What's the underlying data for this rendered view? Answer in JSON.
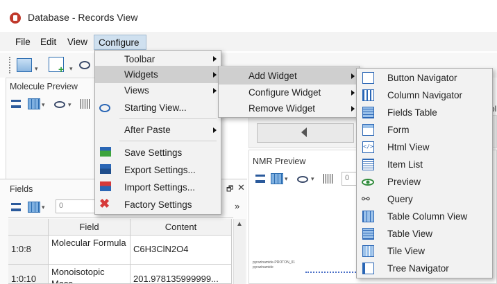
{
  "window": {
    "title": "Database - Records View"
  },
  "menubar": {
    "items": [
      "File",
      "Edit",
      "View",
      "Configure"
    ],
    "active": "Configure"
  },
  "panels": {
    "molecule_preview": {
      "title": "Molecule Preview"
    },
    "fields": {
      "title": "Fields",
      "num_placeholder": "0",
      "more": "»"
    },
    "nmr_preview": {
      "title": "NMR Preview",
      "num_placeholder": "0",
      "spectrum_labels": [
        "pyrazinamide-PROTON_01",
        "pyrazinamide"
      ]
    },
    "right_partial_text": "ol"
  },
  "fields_table": {
    "headers": [
      "Field",
      "Content"
    ],
    "rows": [
      {
        "id": "1:0:8",
        "field": "Molecular Formula",
        "content": "C6H3ClN2O4"
      },
      {
        "id": "1:0:10",
        "field": "Monoisotopic Mass",
        "content": "201.978135999999..."
      }
    ]
  },
  "configure_menu": {
    "items": [
      {
        "label": "Toolbar",
        "submenu": true,
        "icon": ""
      },
      {
        "label": "Widgets",
        "submenu": true,
        "icon": "",
        "highlighted": true
      },
      {
        "label": "Views",
        "submenu": true,
        "icon": ""
      },
      {
        "label": "Starting View...",
        "submenu": false,
        "icon": "view-icon"
      },
      {
        "label": "After Paste",
        "submenu": true,
        "icon": ""
      },
      {
        "label": "Save Settings",
        "submenu": false,
        "icon": "save-settings-icon"
      },
      {
        "label": "Export Settings...",
        "submenu": false,
        "icon": "export-settings-icon"
      },
      {
        "label": "Import Settings...",
        "submenu": false,
        "icon": "import-settings-icon"
      },
      {
        "label": "Factory Settings",
        "submenu": false,
        "icon": "factory-settings-icon"
      }
    ]
  },
  "widgets_menu": {
    "items": [
      {
        "label": "Add Widget",
        "highlighted": true
      },
      {
        "label": "Configure Widget"
      },
      {
        "label": "Remove Widget"
      }
    ]
  },
  "add_widget_menu": {
    "items": [
      {
        "label": "Button Navigator",
        "icon": "button-navigator-icon"
      },
      {
        "label": "Column Navigator",
        "icon": "column-navigator-icon"
      },
      {
        "label": "Fields Table",
        "icon": "fields-table-icon"
      },
      {
        "label": "Form",
        "icon": "form-icon"
      },
      {
        "label": "Html View",
        "icon": "html-view-icon"
      },
      {
        "label": "Item List",
        "icon": "item-list-icon"
      },
      {
        "label": "Preview",
        "icon": "preview-eye-icon"
      },
      {
        "label": "Query",
        "icon": "query-binoculars-icon"
      },
      {
        "label": "Table Column View",
        "icon": "table-column-view-icon"
      },
      {
        "label": "Table View",
        "icon": "table-view-icon"
      },
      {
        "label": "Tile View",
        "icon": "tile-view-icon"
      },
      {
        "label": "Tree Navigator",
        "icon": "tree-navigator-icon"
      }
    ]
  },
  "colors": {
    "accent": "#2a66b5",
    "highlight": "#cfcfcf",
    "logo": "#c0392b"
  }
}
